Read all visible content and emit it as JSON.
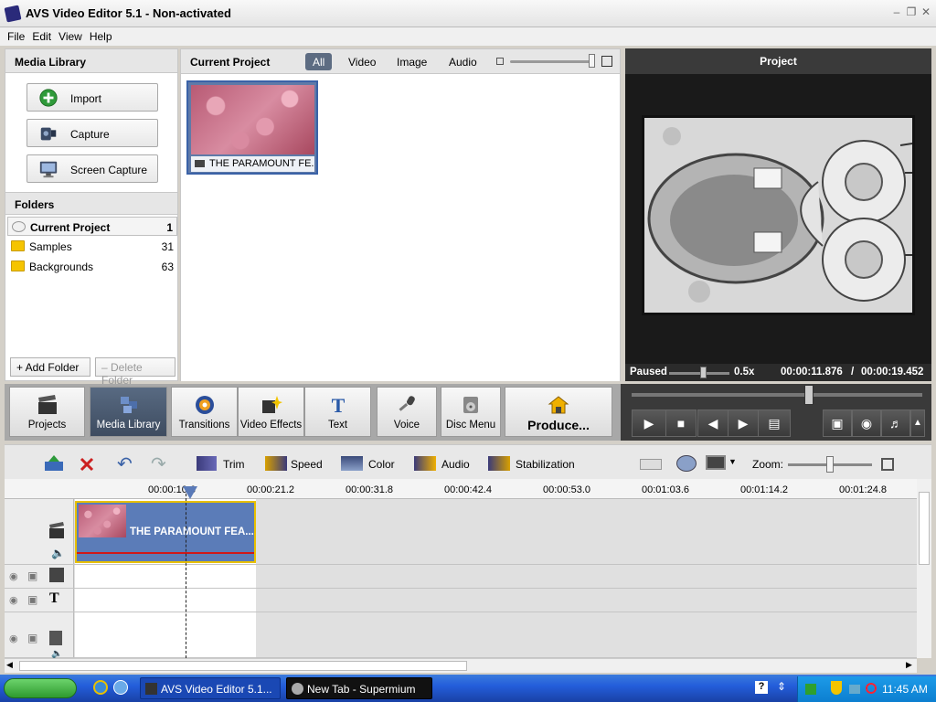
{
  "window": {
    "title": "AVS Video Editor 5.1 - Non-activated"
  },
  "menu": [
    "File",
    "Edit",
    "View",
    "Help"
  ],
  "library": {
    "title": "Media Library",
    "buttons": [
      "Import",
      "Capture",
      "Screen Capture"
    ],
    "folders_title": "Folders",
    "folders": [
      {
        "name": "Current Project",
        "count": "1"
      },
      {
        "name": "Samples",
        "count": "31"
      },
      {
        "name": "Backgrounds",
        "count": "63"
      }
    ],
    "add_folder": "+ Add Folder",
    "delete_folder": "– Delete Folder"
  },
  "project": {
    "title": "Current Project",
    "filters": [
      "All",
      "Video",
      "Image",
      "Audio"
    ],
    "active_filter": "All",
    "clip_name": "THE PARAMOUNT FE..."
  },
  "preview": {
    "title": "Project",
    "status": "Paused",
    "speed": "0.5x",
    "time_current": "00:00:11.876",
    "time_separator": "/",
    "time_total": "00:00:19.452"
  },
  "toolbar": {
    "buttons": [
      "Projects",
      "Media Library",
      "Transitions",
      "Video Effects",
      "Text",
      "Voice",
      "Disc Menu"
    ],
    "active": "Media Library",
    "produce": "Produce..."
  },
  "timeline": {
    "tools": [
      "Trim",
      "Speed",
      "Color",
      "Audio",
      "Stabilization"
    ],
    "zoom_label": "Zoom:",
    "ruler": [
      "00:00:10.6",
      "00:00:21.2",
      "00:00:31.8",
      "00:00:42.4",
      "00:00:53.0",
      "00:01:03.6",
      "00:01:14.2",
      "00:01:24.8"
    ],
    "clip_label": "THE PARAMOUNT FEA..."
  },
  "taskbar": {
    "tasks": [
      "AVS Video Editor 5.1...",
      "New Tab - Supermium"
    ],
    "clock": "11:45 AM"
  }
}
